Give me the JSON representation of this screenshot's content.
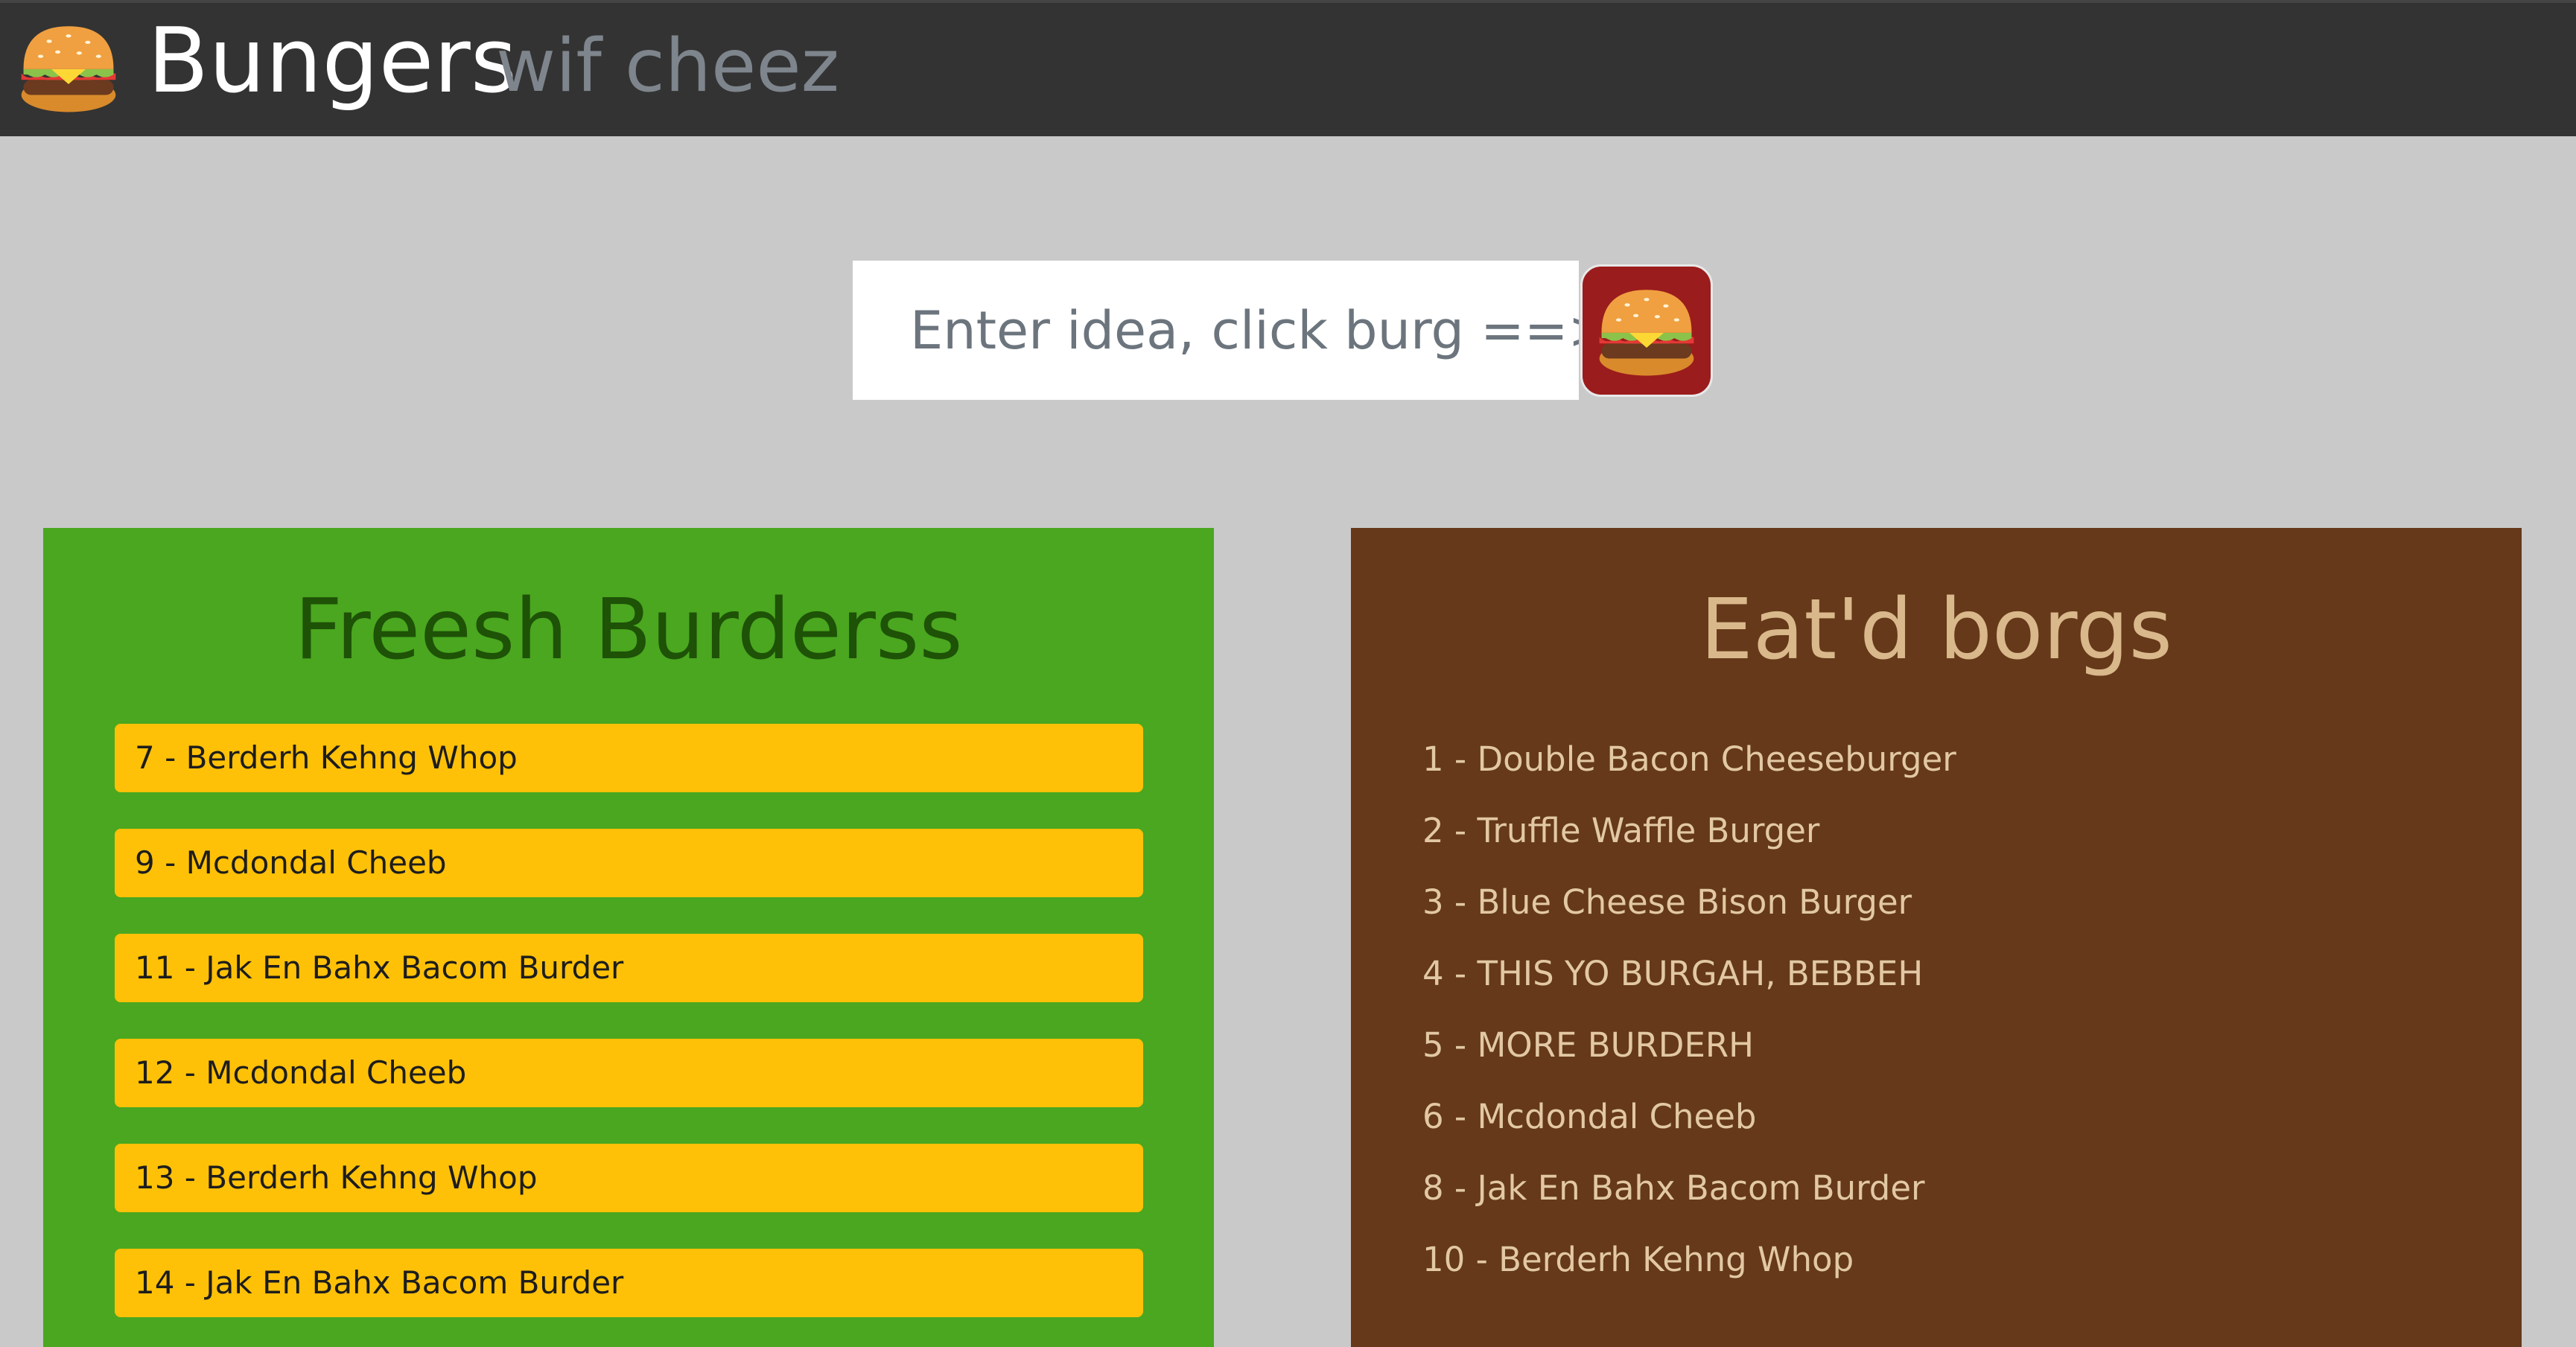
{
  "header": {
    "title": "Bungers",
    "subtitle": "wif cheez",
    "logo_icon": "hamburger-icon"
  },
  "idea_form": {
    "placeholder": "Enter idea, click burg ==>",
    "value": "",
    "submit_icon": "hamburger-icon"
  },
  "fresh": {
    "title": "Freesh Burderss",
    "items": [
      {
        "label": "7 - Berderh Kehng Whop"
      },
      {
        "label": "9 - Mcdondal Cheeb"
      },
      {
        "label": "11 - Jak En Bahx Bacom Burder"
      },
      {
        "label": "12 - Mcdondal Cheeb"
      },
      {
        "label": "13 - Berderh Kehng Whop"
      },
      {
        "label": "14 - Jak En Bahx Bacom Burder"
      }
    ]
  },
  "eaten": {
    "title": "Eat'd borgs",
    "items": [
      {
        "label": "1 - Double Bacon Cheeseburger"
      },
      {
        "label": "2 - Truffle Waffle Burger"
      },
      {
        "label": "3 - Blue Cheese Bison Burger"
      },
      {
        "label": "4 - THIS YO BURGAH, BEBBEH"
      },
      {
        "label": "5 - MORE BURDERH"
      },
      {
        "label": "6 - Mcdondal Cheeb"
      },
      {
        "label": "8 - Jak En Bahx Bacom Burder"
      },
      {
        "label": "10 - Berderh Kehng Whop"
      }
    ]
  },
  "colors": {
    "page_background": "#c9c9c9",
    "navbar": "#333333",
    "fresh_panel": "#4aa71f",
    "fresh_item": "#ffc107",
    "eaten_panel": "#653919",
    "eaten_text": "#e2c8a4",
    "burg_button": "#9b1c1c"
  }
}
